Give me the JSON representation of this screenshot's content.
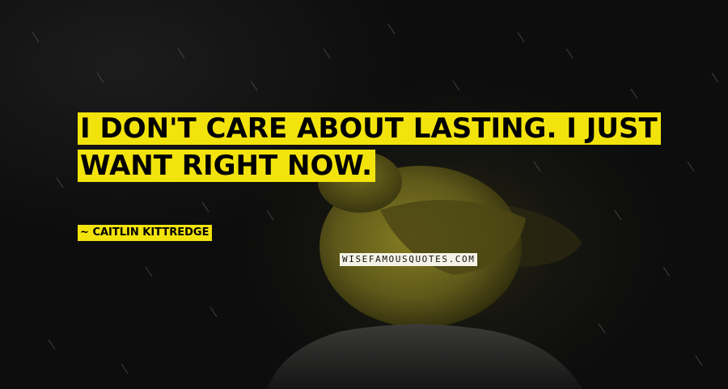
{
  "image": {
    "subject": "yellow bird perched on a rock in the rain",
    "colors": {
      "background": "#0a0a0a",
      "bird_body": "#6b6419",
      "bird_shadow": "#2e2b0d",
      "rock": "#2a2a2a",
      "highlight": "#f2e30d"
    }
  },
  "quote": {
    "text": "I don't care about lasting. I just want right now."
  },
  "author": {
    "prefix": "~",
    "name": "Caitlin Kittredge"
  },
  "watermark": {
    "text": "WISEFAMOUSQUOTES.COM"
  }
}
